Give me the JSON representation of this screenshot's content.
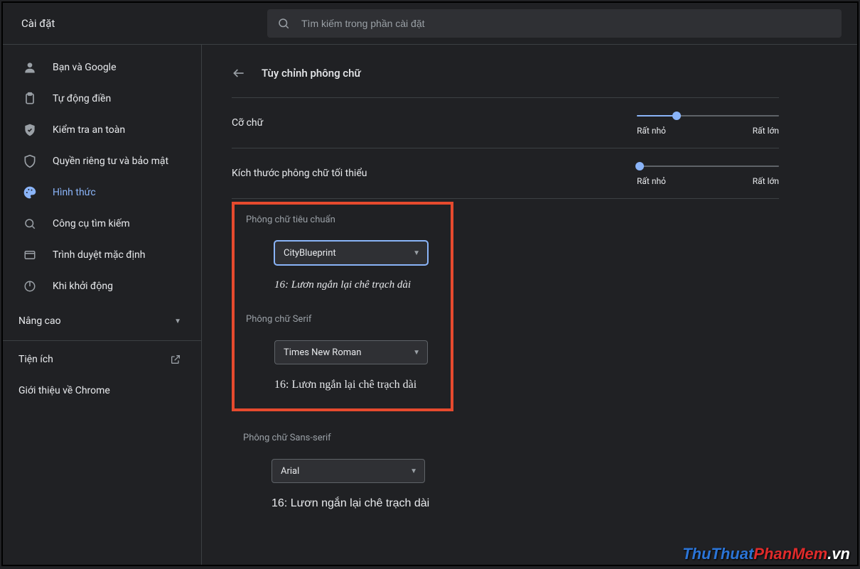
{
  "app_title": "Cài đặt",
  "search": {
    "placeholder": "Tìm kiếm trong phần cài đặt"
  },
  "sidebar": {
    "items": [
      {
        "label": "Bạn và Google"
      },
      {
        "label": "Tự động điền"
      },
      {
        "label": "Kiểm tra an toàn"
      },
      {
        "label": "Quyền riêng tư và bảo mật"
      },
      {
        "label": "Hình thức"
      },
      {
        "label": "Công cụ tìm kiếm"
      },
      {
        "label": "Trình duyệt mặc định"
      },
      {
        "label": "Khi khởi động"
      }
    ],
    "advanced": "Nâng cao",
    "extensions": "Tiện ích",
    "about": "Giới thiệu về Chrome"
  },
  "page": {
    "title": "Tùy chỉnh phông chữ",
    "font_size": {
      "label": "Cỡ chữ",
      "min_label": "Rất nhỏ",
      "max_label": "Rất lớn",
      "percent": 28
    },
    "min_font_size": {
      "label": "Kích thước phông chữ tối thiểu",
      "min_label": "Rất nhỏ",
      "max_label": "Rất lớn",
      "percent": 2
    },
    "fonts": {
      "standard": {
        "title": "Phông chữ tiêu chuẩn",
        "value": "CityBlueprint",
        "preview": "16: Lươn ngắn lại chê trạch dài"
      },
      "serif": {
        "title": "Phông chữ Serif",
        "value": "Times New Roman",
        "preview": "16: Lươn ngắn lại chê trạch dài"
      },
      "sans": {
        "title": "Phông chữ Sans-serif",
        "value": "Arial",
        "preview": "16: Lươn ngắn lại chê trạch dài"
      }
    }
  },
  "watermark": {
    "a": "ThuThuat",
    "b": "PhanMem",
    "c": ".vn"
  }
}
